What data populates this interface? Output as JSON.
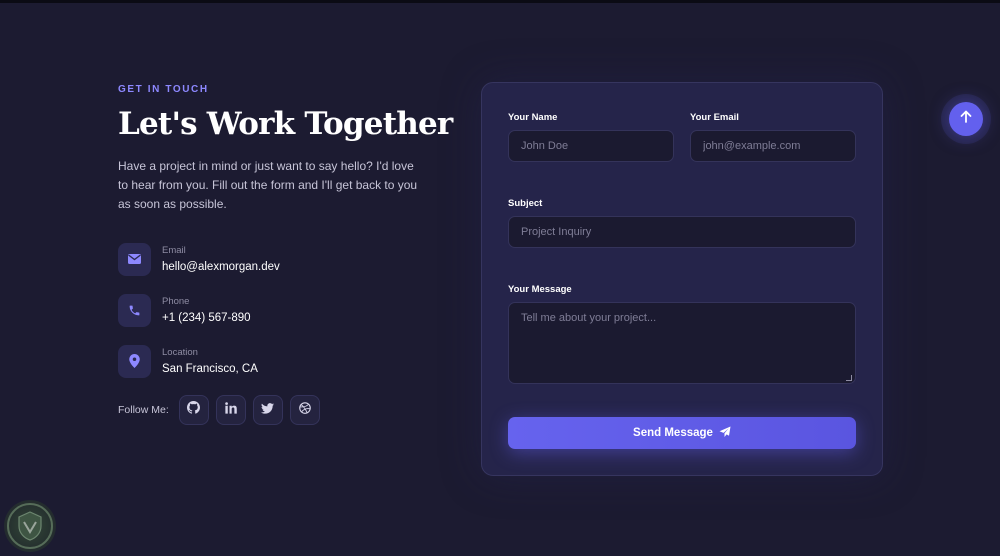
{
  "hero": {
    "eyebrow": "GET IN TOUCH",
    "title": "Let's Work Together",
    "description": "Have a project in mind or just want to say hello? I'd love to hear from you. Fill out the form and I'll get back to you as soon as possible."
  },
  "contacts": {
    "email": {
      "label": "Email",
      "value": "hello@alexmorgan.dev",
      "icon": "envelope-icon"
    },
    "phone": {
      "label": "Phone",
      "value": "+1 (234) 567-890",
      "icon": "phone-icon"
    },
    "location": {
      "label": "Location",
      "value": "San Francisco, CA",
      "icon": "map-pin-icon"
    }
  },
  "follow": {
    "label": "Follow Me:",
    "socials": [
      "github-icon",
      "linkedin-icon",
      "twitter-icon",
      "dribbble-icon"
    ]
  },
  "form": {
    "name_label": "Your Name",
    "name_placeholder": "John Doe",
    "email_label": "Your Email",
    "email_placeholder": "john@example.com",
    "subject_label": "Subject",
    "subject_placeholder": "Project Inquiry",
    "message_label": "Your Message",
    "message_placeholder": "Tell me about your project...",
    "submit_label": "Send Message"
  },
  "colors": {
    "background": "#1c1b31",
    "card": "#25244a",
    "accent": "#6360ee",
    "eyebrow": "#8d88ff"
  }
}
